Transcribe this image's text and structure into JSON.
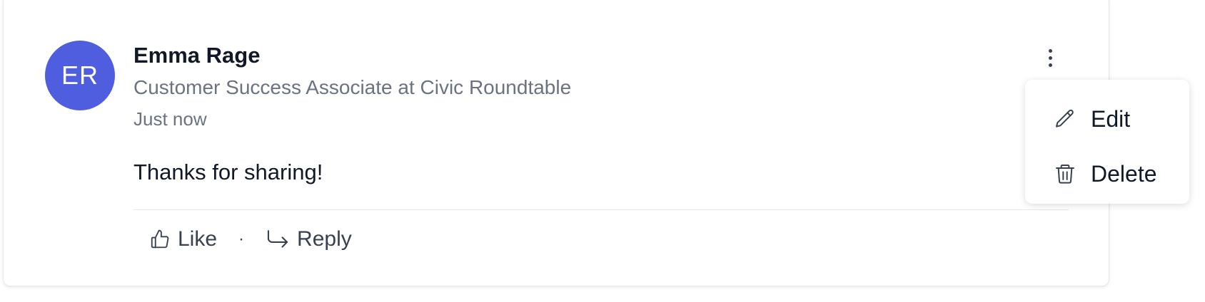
{
  "comment": {
    "author_initials": "ER",
    "author_name": "Emma Rage",
    "author_headline": "Customer Success Associate at Civic Roundtable",
    "timestamp": "Just now",
    "text": "Thanks for sharing!"
  },
  "actions": {
    "like_label": "Like",
    "separator": "·",
    "reply_label": "Reply"
  },
  "menu": {
    "items": [
      {
        "label": "Edit",
        "icon": "pencil-icon"
      },
      {
        "label": "Delete",
        "icon": "trash-icon"
      }
    ]
  },
  "colors": {
    "avatar_bg": "#4f5ddf",
    "secondary_text": "#6b7280",
    "primary_text": "#111827"
  }
}
